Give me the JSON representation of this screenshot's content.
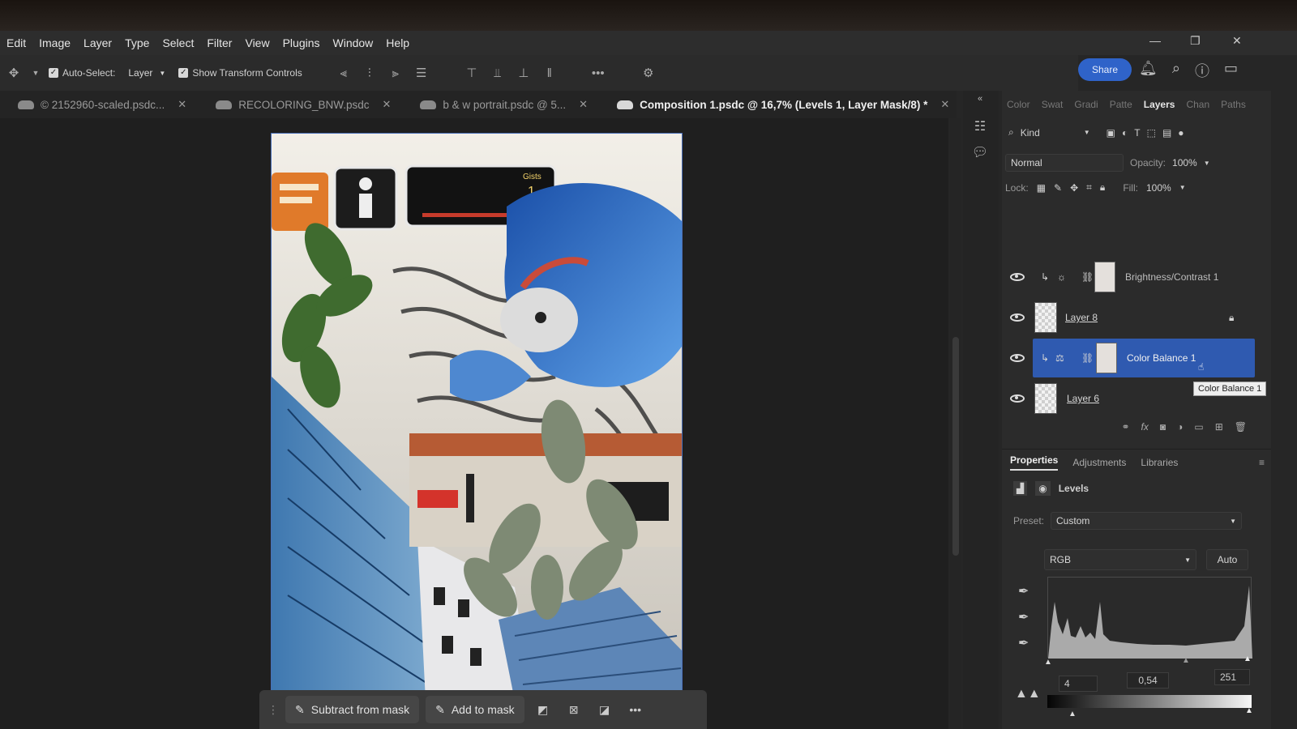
{
  "menu": [
    "Edit",
    "Image",
    "Layer",
    "Type",
    "Select",
    "Filter",
    "View",
    "Plugins",
    "Window",
    "Help"
  ],
  "options_bar": {
    "auto_select_label": "Auto-Select:",
    "auto_select_target": "Layer",
    "show_transform_label": "Show Transform Controls",
    "more": "•••"
  },
  "share_label": "Share",
  "tabs": [
    {
      "label": "© 2152960-scaled.psdc...",
      "active": false
    },
    {
      "label": "RECOLORING_BNW.psdc",
      "active": false
    },
    {
      "label": "b & w portrait.psdc @ 5...",
      "active": false
    },
    {
      "label": "Composition 1.psdc @ 16,7% (Levels 1, Layer Mask/8) *",
      "active": true
    }
  ],
  "canvas_art": {
    "score_label": "Gists",
    "score_value": "1"
  },
  "taskbar": {
    "subtract_label": "Subtract from mask",
    "add_label": "Add to mask",
    "more": "•••"
  },
  "layers_panel": {
    "tabs": [
      "Color",
      "Swat",
      "Gradi",
      "Patte",
      "Layers",
      "Chan",
      "Paths"
    ],
    "active_tab": "Layers",
    "filter_label": "Kind",
    "blend_mode": "Normal",
    "opacity_label": "Opacity:",
    "opacity_value": "100%",
    "lock_label": "Lock:",
    "fill_label": "Fill:",
    "fill_value": "100%",
    "layers": [
      {
        "name": "Brightness/Contrast 1",
        "type": "adjustment",
        "selected": false
      },
      {
        "name": "Layer 8",
        "type": "pixel",
        "selected": false,
        "locked": true
      },
      {
        "name": "Color Balance 1",
        "type": "adjustment",
        "selected": true
      },
      {
        "name": "Layer 6",
        "type": "pixel",
        "selected": false
      }
    ],
    "tooltip": "Color Balance 1"
  },
  "properties": {
    "tabs": [
      "Properties",
      "Adjustments",
      "Libraries"
    ],
    "active_tab": "Properties",
    "title": "Levels",
    "preset_label": "Preset:",
    "preset_value": "Custom",
    "channel": "RGB",
    "auto_label": "Auto",
    "input_black": "4",
    "input_gamma": "0,54",
    "input_white": "251"
  },
  "colors": {
    "accent": "#2f63c9",
    "selected_layer": "#2f5ab0",
    "panel_bg": "#2b2b2b",
    "canvas_bg": "#1f1f1f"
  }
}
